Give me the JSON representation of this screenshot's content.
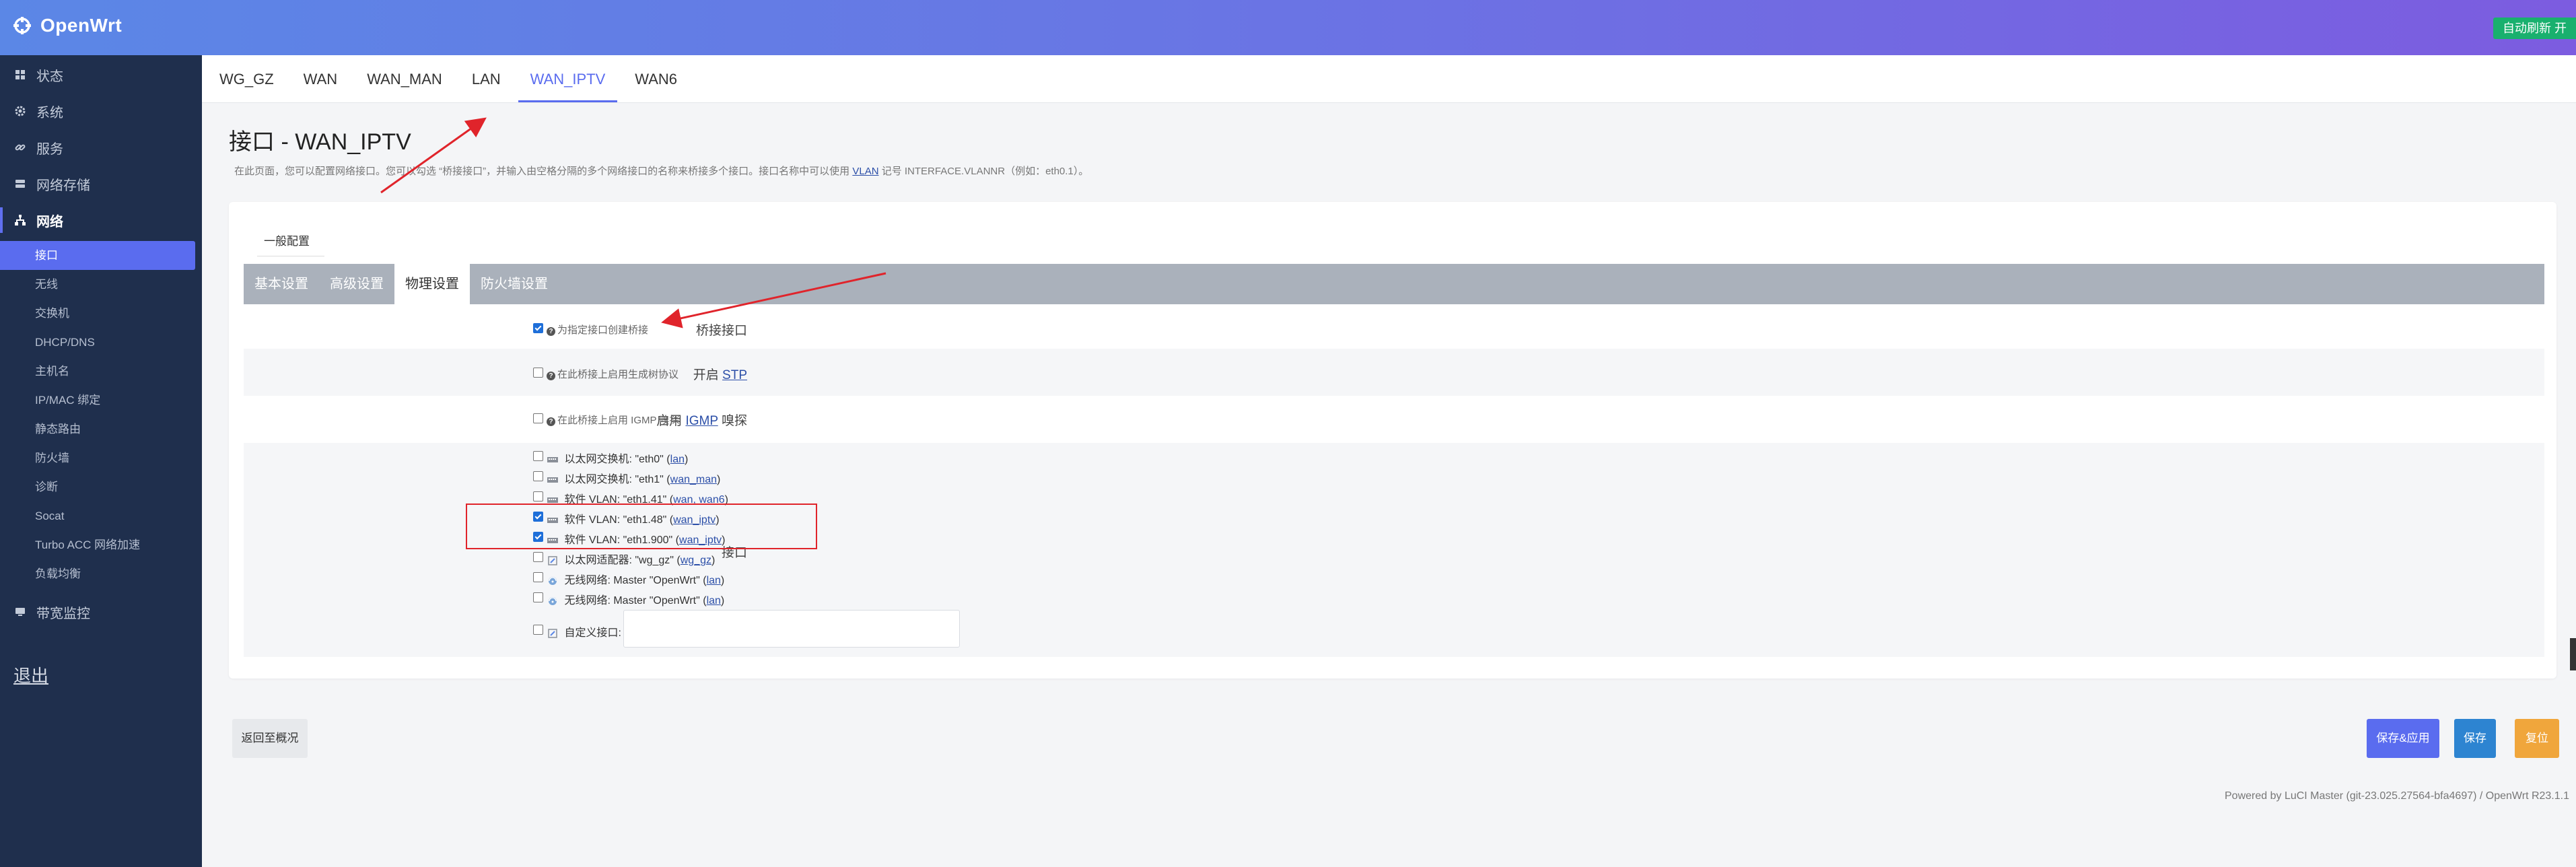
{
  "brand": {
    "name": "OpenWrt"
  },
  "header": {
    "refresh_label": "自动刷新 开"
  },
  "sidebar": {
    "items": [
      {
        "label": "状态",
        "icon": "dashboard-icon"
      },
      {
        "label": "系统",
        "icon": "gear-icon"
      },
      {
        "label": "服务",
        "icon": "link-icon"
      },
      {
        "label": "网络存储",
        "icon": "storage-icon"
      },
      {
        "label": "网络",
        "icon": "network-icon"
      }
    ],
    "network_sub": [
      "接口",
      "无线",
      "交换机",
      "DHCP/DNS",
      "主机名",
      "IP/MAC 绑定",
      "静态路由",
      "防火墙",
      "诊断",
      "Socat",
      "Turbo ACC 网络加速",
      "负载均衡"
    ],
    "bandwidth": {
      "label": "带宽监控",
      "icon": "monitor-icon"
    },
    "logout": "退出"
  },
  "tabs": [
    "WG_GZ",
    "WAN",
    "WAN_MAN",
    "LAN",
    "WAN_IPTV",
    "WAN6"
  ],
  "page": {
    "title": "接口 - WAN_IPTV",
    "desc_before": "在此页面，您可以配置网络接口。您可以勾选 “桥接接口”，并输入由空格分隔的多个网络接口的名称来桥接多个接口。接口名称中可以使用",
    "desc_vlan": "VLAN",
    "desc_after": "记号 INTERFACE.VLANNR（例如：eth0.1）。"
  },
  "section": {
    "legend": "一般配置",
    "subtabs": [
      "基本设置",
      "高级设置",
      "物理设置",
      "防火墙设置"
    ]
  },
  "fields": {
    "bridge": {
      "label": "桥接接口",
      "help": "为指定接口创建桥接"
    },
    "stp": {
      "label_pre": "开启",
      "label_abbr": "STP",
      "help": "在此桥接上启用生成树协议"
    },
    "igmp": {
      "label_pre": "启用",
      "label_abbr": "IGMP",
      "label_post": "嗅探",
      "help": "在此桥接上启用 IGMP 嗅探"
    },
    "iface_label": "接口"
  },
  "interfaces": [
    {
      "text": "以太网交换机: \"eth0\"",
      "net": "lan",
      "checked": false,
      "icon": "ethernet-switch-icon"
    },
    {
      "text": "以太网交换机: \"eth1\"",
      "net": "wan_man",
      "checked": false,
      "icon": "ethernet-switch-icon"
    },
    {
      "text": "软件 VLAN: \"eth1.41\"",
      "net": "wan, wan6",
      "checked": false,
      "icon": "vlan-icon"
    },
    {
      "text": "软件 VLAN: \"eth1.48\"",
      "net": "wan_iptv",
      "checked": true,
      "icon": "vlan-icon"
    },
    {
      "text": "软件 VLAN: \"eth1.900\"",
      "net": "wan_iptv",
      "checked": true,
      "icon": "vlan-icon"
    },
    {
      "text": "以太网适配器: \"wg_gz\"",
      "net": "wg_gz",
      "checked": false,
      "icon": "ethernet-adapter-icon"
    },
    {
      "text": "无线网络: Master \"OpenWrt\"",
      "net": "lan",
      "checked": false,
      "icon": "wireless-icon"
    },
    {
      "text": "无线网络: Master \"OpenWrt\"",
      "net": "lan",
      "checked": false,
      "icon": "wireless-icon"
    }
  ],
  "custom_iface": {
    "label": "自定义接口:"
  },
  "buttons": {
    "back": "返回至概况",
    "save_apply": "保存&应用",
    "save": "保存",
    "reset": "复位"
  },
  "footer": "Powered by LuCI Master (git-23.025.27564-bfa4697) / OpenWrt R23.1.1",
  "colors": {
    "accent": "#5a6cef",
    "sidebar": "#1f2f4d",
    "annotation": "#e0242b"
  }
}
